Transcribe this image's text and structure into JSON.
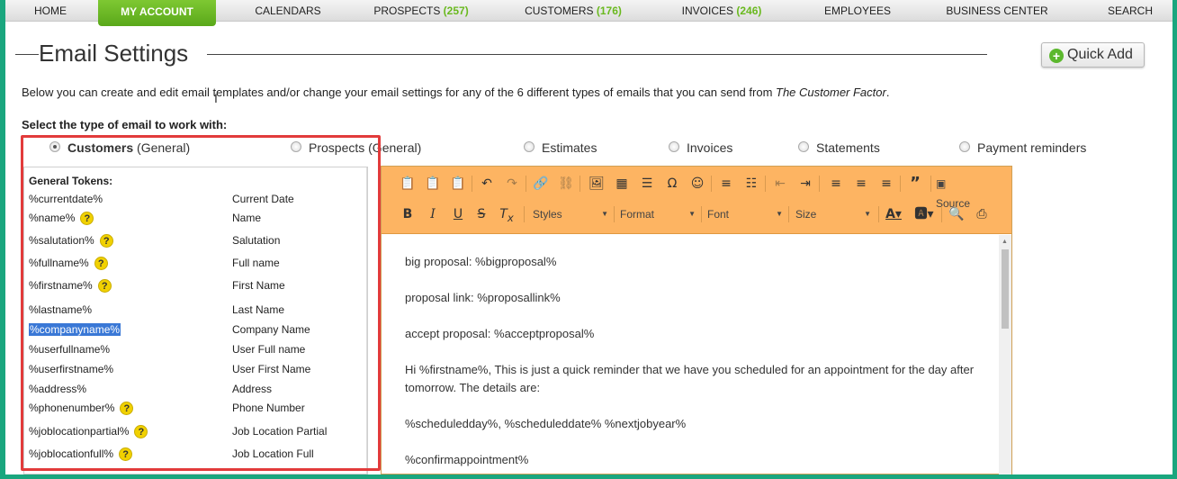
{
  "nav": {
    "items": [
      {
        "label": "HOME",
        "count": ""
      },
      {
        "label": "CALENDARS",
        "count": ""
      },
      {
        "label": "PROSPECTS",
        "count": "(257)"
      },
      {
        "label": "CUSTOMERS",
        "count": "(176)"
      },
      {
        "label": "INVOICES",
        "count": "(246)"
      },
      {
        "label": "EMPLOYEES",
        "count": ""
      },
      {
        "label": "BUSINESS CENTER",
        "count": ""
      },
      {
        "label": "SEARCH",
        "count": ""
      }
    ],
    "active": "MY ACCOUNT"
  },
  "page": {
    "title": "Email Settings",
    "quick_add": "Quick Add",
    "intro": "Below you can create and edit email templates and/or change your email settings for any of the 6 different types of emails that you can send from ",
    "intro_italic": "The Customer Factor",
    "intro_end": ".",
    "select_label": "Select the type of email to work with:"
  },
  "email_types": [
    {
      "label": "Customers",
      "suffix": " (General)",
      "selected": true
    },
    {
      "label": "Prospects (General)",
      "suffix": "",
      "selected": false
    },
    {
      "label": "Estimates",
      "suffix": "",
      "selected": false
    },
    {
      "label": "Invoices",
      "suffix": "",
      "selected": false
    },
    {
      "label": "Statements",
      "suffix": "",
      "selected": false
    },
    {
      "label": "Payment reminders",
      "suffix": "",
      "selected": false
    }
  ],
  "tokens": {
    "heading": "General Tokens:",
    "rows": [
      {
        "token": "%currentdate%",
        "desc": "Current Date",
        "help": false
      },
      {
        "token": "%name%",
        "desc": "Name",
        "help": true
      },
      {
        "token": "%salutation%",
        "desc": "Salutation",
        "help": true
      },
      {
        "token": "%fullname%",
        "desc": "Full name",
        "help": true
      },
      {
        "token": "%firstname%",
        "desc": "First Name",
        "help": true
      },
      {
        "token": "%lastname%",
        "desc": "Last Name",
        "help": false
      },
      {
        "token": "%companyname%",
        "desc": "Company Name",
        "help": false,
        "selected": true
      },
      {
        "token": "%userfullname%",
        "desc": "User Full name",
        "help": false
      },
      {
        "token": "%userfirstname%",
        "desc": "User First Name",
        "help": false
      },
      {
        "token": "%address%",
        "desc": "Address",
        "help": false
      },
      {
        "token": "%phonenumber%",
        "desc": "Phone Number",
        "help": true
      },
      {
        "token": "%joblocationpartial%",
        "desc": "Job Location Partial",
        "help": true
      },
      {
        "token": "%joblocationfull%",
        "desc": "Job Location Full",
        "help": true
      }
    ]
  },
  "editor": {
    "styles": "Styles",
    "format": "Format",
    "font": "Font",
    "size": "Size",
    "source": "Source",
    "paragraphs": [
      "big proposal:  %bigproposal%",
      "proposal link: %proposallink%",
      "accept proposal:  %acceptproposal%",
      "Hi %firstname%, This is just a quick reminder that we have you scheduled for an appointment for the day after tomorrow. The details are:",
      "%scheduledday%, %scheduleddate% %nextjobyear%",
      "%confirmappointment%"
    ]
  },
  "colors": {
    "accent_green": "#6ab91f",
    "toolbar_orange": "#fdb462",
    "highlight_red": "#e23b3b",
    "selection_blue": "#3a78d6"
  }
}
